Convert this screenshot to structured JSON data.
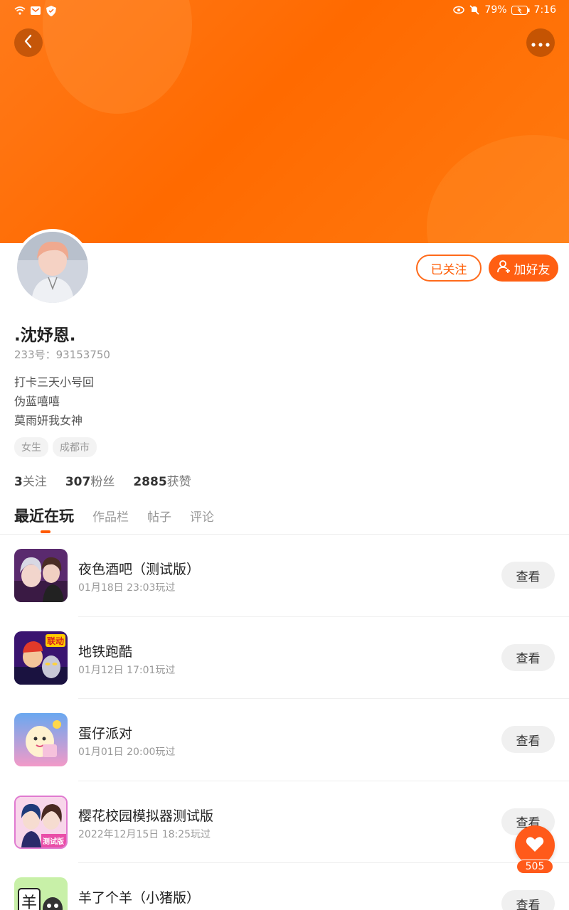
{
  "status": {
    "battery": "79%",
    "time": "7:16"
  },
  "header": {
    "back_icon": "chevron-left-icon",
    "more_icon": "more-dots-icon"
  },
  "profile": {
    "follow_label": "已关注",
    "add_friend_label": "加好友",
    "username": ".沈妤恩.",
    "uid": "233号：93153750",
    "bio": [
      "打卡三天小号回",
      "伪蓝嘻嘻",
      "莫雨妍我女神"
    ],
    "tags": [
      "女生",
      "成都市"
    ]
  },
  "stats": [
    {
      "count": "3",
      "label": "关注"
    },
    {
      "count": "307",
      "label": "粉丝"
    },
    {
      "count": "2885",
      "label": "获赞"
    }
  ],
  "tabs": [
    "最近在玩",
    "作品栏",
    "帖子",
    "评论"
  ],
  "games": [
    {
      "name": "夜色酒吧（测试版）",
      "time": "01月18日 23:03玩过",
      "action": "查看"
    },
    {
      "name": "地铁跑酷",
      "time": "01月12日 17:01玩过",
      "action": "查看"
    },
    {
      "name": "蛋仔派对",
      "time": "01月01日 20:00玩过",
      "action": "查看"
    },
    {
      "name": "樱花校园模拟器测试版",
      "time": "2022年12月15日 18:25玩过",
      "action": "查看"
    },
    {
      "name": "羊了个羊（小猪版）",
      "time": "",
      "action": "查看"
    }
  ],
  "icon_text": {
    "subway": "联动",
    "sakura": "测试版",
    "sheep": "羊"
  },
  "fab": {
    "count": "505"
  },
  "colors": {
    "accent": "#ff5a00",
    "hero": "#ff6a00"
  }
}
